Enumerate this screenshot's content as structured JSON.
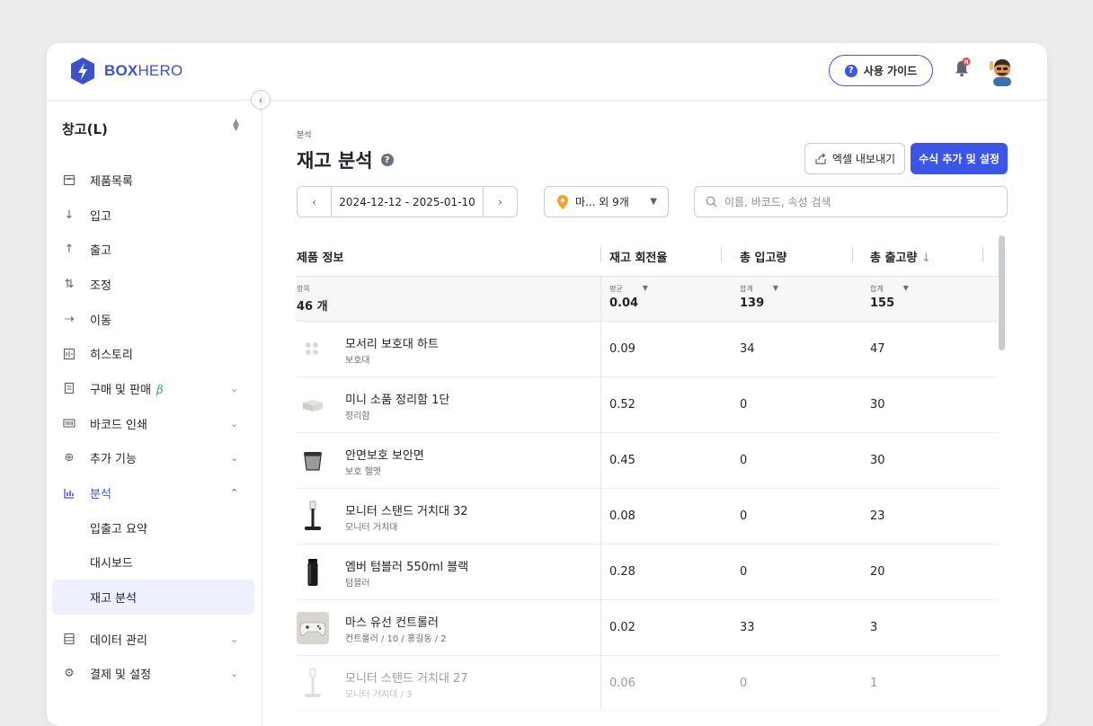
{
  "header": {
    "logo_bold": "BOX",
    "logo_light": "HERO",
    "guide_label": "사용 가이드",
    "notification_badge": "N"
  },
  "sidebar": {
    "warehouse": "창고(L)",
    "items": [
      {
        "label": "제품목록",
        "icon": "box-icon"
      },
      {
        "label": "입고",
        "icon": "arrow-down-icon"
      },
      {
        "label": "출고",
        "icon": "arrow-up-icon"
      },
      {
        "label": "조정",
        "icon": "swap-icon"
      },
      {
        "label": "이동",
        "icon": "move-icon"
      },
      {
        "label": "히스토리",
        "icon": "history-icon"
      },
      {
        "label": "구매 및 판매",
        "icon": "document-icon",
        "badge": "β"
      },
      {
        "label": "바코드 인쇄",
        "icon": "barcode-icon"
      },
      {
        "label": "추가 기능",
        "icon": "plus-circle-icon"
      },
      {
        "label": "분석",
        "icon": "chart-icon"
      },
      {
        "label": "데이터 관리",
        "icon": "database-icon"
      },
      {
        "label": "결제 및 설정",
        "icon": "gear-icon"
      }
    ],
    "analysis_sub": [
      "입출고 요약",
      "대시보드",
      "재고 분석"
    ]
  },
  "main": {
    "breadcrumb": "분석",
    "title": "재고 분석",
    "excel_label": "엑셀 내보내기",
    "formula_label": "수식 추가 및 설정",
    "date_range": "2024-12-12 - 2025-01-10",
    "location_filter": "마... 외 9개",
    "search_placeholder": "이름, 바코드, 속성 검색"
  },
  "table": {
    "columns": [
      "제품 정보",
      "재고 회전율",
      "총 입고량",
      "총 출고량"
    ],
    "summary": {
      "items_label": "항목",
      "items_value": "46 개",
      "avg_label": "평균",
      "avg_value": "0.04",
      "sum_label": "합계",
      "in_total": "139",
      "out_total": "155"
    },
    "rows": [
      {
        "name": "모서리 보호대 하트",
        "category": "보호대",
        "turnover": "0.09",
        "in": "34",
        "out": "47"
      },
      {
        "name": "미니 소품 정리함 1단",
        "category": "정리함",
        "turnover": "0.52",
        "in": "0",
        "out": "30"
      },
      {
        "name": "안면보호 보안면",
        "category": "보호 헬멧",
        "turnover": "0.45",
        "in": "0",
        "out": "30"
      },
      {
        "name": "모니터 스탠드 거치대 32",
        "category": "모니터 거치대",
        "turnover": "0.08",
        "in": "0",
        "out": "23"
      },
      {
        "name": "엠버 텀블러 550ml 블랙",
        "category": "텀블러",
        "turnover": "0.28",
        "in": "0",
        "out": "20"
      },
      {
        "name": "마스 유선 컨트롤러",
        "category": "컨트롤러 / 10 / 홍길동 / 2",
        "turnover": "0.02",
        "in": "33",
        "out": "3"
      },
      {
        "name": "모니터 스탠드 거치대 27",
        "category": "모니터 거치대 / 3",
        "turnover": "0.06",
        "in": "0",
        "out": "1"
      }
    ]
  },
  "colors": {
    "accent": "#3b55e6",
    "beta": "#2fae6a",
    "location_pin": "#f2a227",
    "badge": "#e5484d"
  }
}
